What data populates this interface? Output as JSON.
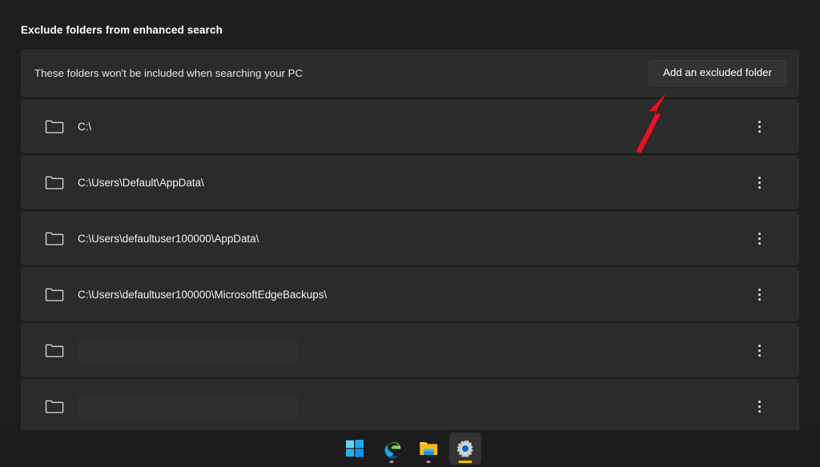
{
  "page": {
    "section_title": "Exclude folders from enhanced search",
    "background_color": "#1e1e1e",
    "card_color": "#2b2b2b"
  },
  "header_card": {
    "description": "These folders won't be included when searching your PC",
    "add_button_label": "Add an excluded folder"
  },
  "folder_rows": [
    {
      "icon": "folder-icon",
      "path": "C:\\",
      "redacted": false,
      "menu_icon": "kebab-menu-icon"
    },
    {
      "icon": "folder-icon",
      "path": "C:\\Users\\Default\\AppData\\",
      "redacted": false,
      "menu_icon": "kebab-menu-icon"
    },
    {
      "icon": "folder-icon",
      "path": "C:\\Users\\defaultuser100000\\AppData\\",
      "redacted": false,
      "menu_icon": "kebab-menu-icon"
    },
    {
      "icon": "folder-icon",
      "path": "C:\\Users\\defaultuser100000\\MicrosoftEdgeBackups\\",
      "redacted": false,
      "menu_icon": "kebab-menu-icon"
    },
    {
      "icon": "folder-icon",
      "path": "",
      "redacted": true,
      "menu_icon": "kebab-menu-icon"
    },
    {
      "icon": "folder-icon",
      "path": "",
      "redacted": true,
      "menu_icon": "kebab-menu-icon"
    }
  ],
  "annotation": {
    "type": "arrow",
    "color": "#e81123",
    "points_to": "Add an excluded folder"
  },
  "taskbar": {
    "items": [
      {
        "name": "start-button",
        "icon": "windows-logo-icon",
        "active": false,
        "running": false
      },
      {
        "name": "edge-button",
        "icon": "microsoft-edge-icon",
        "active": false,
        "running": true
      },
      {
        "name": "file-explorer-button",
        "icon": "file-explorer-icon",
        "active": false,
        "running": true
      },
      {
        "name": "settings-button",
        "icon": "settings-gear-icon",
        "active": true,
        "running": true
      }
    ],
    "active_indicator_color": "#f2c200"
  }
}
